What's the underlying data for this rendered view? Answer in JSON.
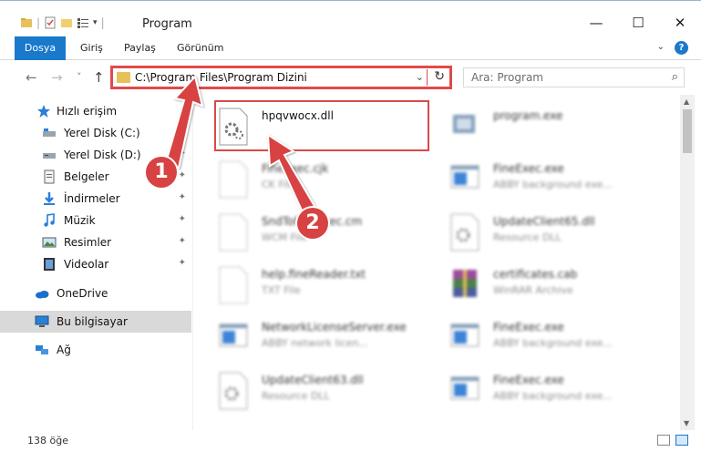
{
  "window": {
    "title": "Program",
    "minimize": "—",
    "maximize": "☐",
    "close": "✕"
  },
  "ribbon": {
    "tabs": [
      "Dosya",
      "Giriş",
      "Paylaş",
      "Görünüm"
    ],
    "help": "?"
  },
  "nav": {
    "back": "←",
    "forward": "→",
    "recent": "˅",
    "up": "↑",
    "address": "C:\\Program Files\\Program Dizini",
    "refresh": "↻",
    "search_placeholder": "Ara: Program"
  },
  "sidebar": {
    "items": [
      {
        "label": "Hızlı erişim",
        "icon": "star-icon"
      },
      {
        "label": "Yerel Disk (C:)",
        "icon": "drive-icon",
        "pinned": true
      },
      {
        "label": "Yerel Disk (D:)",
        "icon": "drive-icon",
        "pinned": true
      },
      {
        "label": "Belgeler",
        "icon": "documents-icon",
        "pinned": true
      },
      {
        "label": "İndirmeler",
        "icon": "download-icon",
        "pinned": true
      },
      {
        "label": "Müzik",
        "icon": "music-icon",
        "pinned": true
      },
      {
        "label": "Resimler",
        "icon": "pictures-icon",
        "pinned": true
      },
      {
        "label": "Videolar",
        "icon": "videos-icon",
        "pinned": true
      },
      {
        "label": "OneDrive",
        "icon": "onedrive-icon"
      },
      {
        "label": "Bu bilgisayar",
        "icon": "computer-icon",
        "selected": true
      },
      {
        "label": "Ağ",
        "icon": "network-icon"
      }
    ],
    "pin_glyph": "📌"
  },
  "files": [
    {
      "name": "hpqvwocx.dll",
      "desc": "",
      "icon": "dll-gear-icon",
      "highlight": true
    },
    {
      "name": "program.exe",
      "desc": "",
      "icon": "exe-icon"
    },
    {
      "name": "FineExec.cjk",
      "desc": "CK File",
      "icon": "blank-file-icon"
    },
    {
      "name": "FineExec.exe",
      "desc": "ABBY background exe...",
      "icon": "window-app-icon"
    },
    {
      "name": "SndToFineExec.cm",
      "desc": "WCM File",
      "icon": "blank-file-icon"
    },
    {
      "name": "UpdateClient65.dll",
      "desc": "Resource DLL",
      "icon": "dll-gear-icon"
    },
    {
      "name": "help.fineReader.txt",
      "desc": "TXT File",
      "icon": "blank-file-icon"
    },
    {
      "name": "certificates.cab",
      "desc": "WinRAR Archive",
      "icon": "winrar-icon"
    },
    {
      "name": "NetworkLicenseServer.exe",
      "desc": "ABBY network licen...",
      "icon": "window-app-icon"
    },
    {
      "name": "FineExec.exe",
      "desc": "ABBY background exe...",
      "icon": "window-app-icon"
    },
    {
      "name": "UpdateClient63.dll",
      "desc": "Resource DLL",
      "icon": "dll-gear-icon"
    },
    {
      "name": "FineExec.exe",
      "desc": "ABBY background exe...",
      "icon": "window-app-icon"
    }
  ],
  "status": {
    "count": "138 öğe"
  },
  "callouts": [
    "1",
    "2"
  ],
  "colors": {
    "accent": "#1979ca",
    "highlight_red": "#d84a4a",
    "folder": "#e8c05a"
  }
}
